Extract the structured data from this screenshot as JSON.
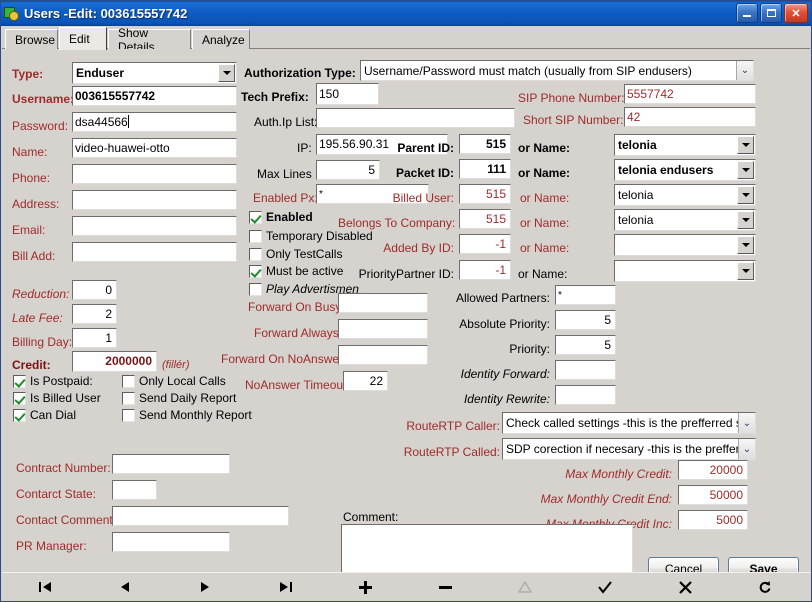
{
  "window": {
    "title": "Users -Edit: 003615557742",
    "icon": "users-app-icon",
    "minimize_label": "Minimize",
    "maximize_label": "Maximize",
    "close_label": "Close"
  },
  "tabs": [
    {
      "label": "Browse",
      "active": false
    },
    {
      "label": "Edit",
      "active": true
    },
    {
      "label": "Show Details",
      "active": false
    },
    {
      "label": "Analyze",
      "active": false
    }
  ],
  "left_column": {
    "type_label": "Type:",
    "type_value": "Enduser",
    "username_label": "Username:",
    "username_value": "003615557742",
    "password_label": "Password:",
    "password_value": "dsa44566",
    "name_label": "Name:",
    "name_value": "video-huawei-otto",
    "phone_label": "Phone:",
    "phone_value": "",
    "address_label": "Address:",
    "address_value": "",
    "email_label": "Email:",
    "email_value": "",
    "bill_add_label": "Bill Add:",
    "bill_add_value": "",
    "reduction_label": "Reduction:",
    "reduction_value": "0",
    "late_fee_label": "Late Fee:",
    "late_fee_value": "2",
    "billing_day_label": "Billing Day:",
    "billing_day_value": "1",
    "credit_label": "Credit:",
    "credit_value": "2000000",
    "credit_unit": "(fillér)"
  },
  "left_checkboxes": [
    {
      "label": "Is Postpaid:",
      "checked": true
    },
    {
      "label": "Is Billed User",
      "checked": true
    },
    {
      "label": "Can Dial",
      "checked": true
    },
    {
      "label": "Only Local Calls",
      "checked": false
    },
    {
      "label": "Send Daily Report",
      "checked": false
    },
    {
      "label": "Send Monthly Report",
      "checked": false
    }
  ],
  "middle_column": {
    "authorization_type_label": "Authorization Type:",
    "authorization_type_value": "Username/Password must match (usually from SIP endusers)",
    "tech_prefix_label": "Tech Prefix:",
    "tech_prefix_value": "150",
    "auth_ip_list_label": "Auth.Ip List:",
    "auth_ip_list_value": "",
    "ip_label": "IP:",
    "ip_value": "195.56.90.31",
    "max_lines_label": "Max Lines",
    "max_lines_value": "5",
    "enabled_px_label": "Enabled Px:",
    "enabled_px_value": "*",
    "forward_on_busy_label": "Forward On Busy:",
    "forward_on_busy_value": "",
    "forward_always_label": "Forward Always:",
    "forward_always_value": "",
    "forward_on_noanswer_label": "Forward On NoAnswer:",
    "forward_on_noanswer_value": "",
    "noanswer_timeout_label": "NoAnswer Timeout:",
    "noanswer_timeout_value": "22"
  },
  "middle_checkboxes": [
    {
      "label": "Enabled",
      "checked": true,
      "style": "bold"
    },
    {
      "label": "Temporary Disabled",
      "checked": false,
      "style": "normal"
    },
    {
      "label": "Only TestCalls",
      "checked": false,
      "style": "normal"
    },
    {
      "label": "Must be active",
      "checked": true,
      "style": "normal"
    },
    {
      "label": "Play Advertismen",
      "checked": false,
      "style": "italic"
    }
  ],
  "right_column": {
    "sip_phone_number_label": "SIP Phone Number:",
    "sip_phone_number_value": "5557742",
    "short_sip_number_label": "Short SIP Number:",
    "short_sip_number_value": "42",
    "or_name_label": "or Name:",
    "id_rows": [
      {
        "label": "Parent ID:",
        "id_value": "515",
        "name_value": "telonia",
        "bold": true
      },
      {
        "label": "Packet ID:",
        "id_value": "111",
        "name_value": "telonia endusers",
        "bold": true
      },
      {
        "label": "Billed User:",
        "id_value": "515",
        "name_value": "telonia",
        "bold": false
      },
      {
        "label": "Belongs To Company:",
        "id_value": "515",
        "name_value": "telonia",
        "bold": false
      },
      {
        "label": "Added By ID:",
        "id_value": "-1",
        "name_value": "",
        "bold": false
      },
      {
        "label": "PriorityPartner ID:",
        "id_value": "-1",
        "name_value": "",
        "bold": false
      }
    ],
    "allowed_partners_label": "Allowed Partners:",
    "allowed_partners_value": "*",
    "absolute_priority_label": "Absolute Priority:",
    "absolute_priority_value": "5",
    "priority_label": "Priority:",
    "priority_value": "5",
    "identity_forward_label": "Identity Forward:",
    "identity_forward_value": "",
    "identity_rewrite_label": "Identity Rewrite:",
    "identity_rewrite_value": "",
    "routertp_caller_label": "RouteRTP Caller:",
    "routertp_caller_value": "Check called settings -this is the prefferred settin",
    "routertp_called_label": "RouteRTP Called:",
    "routertp_called_value": "SDP corection if necesary  -this is the prefferred"
  },
  "contract": {
    "contract_number_label": "Contract Number:",
    "contract_number_value": "",
    "contract_state_label": "Contarct State:",
    "contract_state_value": "",
    "contact_comment_label": "Contact Comment:",
    "contact_comment_value": "",
    "pr_manager_label": "PR Manager:",
    "pr_manager_value": ""
  },
  "comment": {
    "label": "Comment:",
    "value": ""
  },
  "max_monthly": {
    "credit_label": "Max Monthly Credit:",
    "credit_value": "20000",
    "credit_end_label": "Max Monthly Credit End:",
    "credit_end_value": "50000",
    "credit_inc_label": "Max Monthly Credit Inc:",
    "credit_inc_value": "5000"
  },
  "actions": {
    "cancel_label": "Cancel",
    "save_label": "Save"
  },
  "navigator": [
    {
      "name": "first-record",
      "glyph": "|◀",
      "disabled": false
    },
    {
      "name": "prior-record",
      "glyph": "◀",
      "disabled": false
    },
    {
      "name": "next-record",
      "glyph": "▶",
      "disabled": false
    },
    {
      "name": "last-record",
      "glyph": "▶|",
      "disabled": false
    },
    {
      "name": "insert-record",
      "glyph": "✚",
      "disabled": false
    },
    {
      "name": "delete-record",
      "glyph": "▬",
      "disabled": false
    },
    {
      "name": "edit-record",
      "glyph": "△",
      "disabled": true
    },
    {
      "name": "post-record",
      "glyph": "✔",
      "disabled": false
    },
    {
      "name": "cancel-record",
      "glyph": "✘",
      "disabled": false
    },
    {
      "name": "refresh-record",
      "glyph": "↻",
      "disabled": false
    }
  ],
  "colors": {
    "label_red": "#9e2b2b",
    "label_dark_red": "#7a1414",
    "form_bg": "#d6d3ce",
    "title_blue": "#0f5ec4",
    "close_red": "#e0523a",
    "check_green": "#1d8a2a"
  }
}
